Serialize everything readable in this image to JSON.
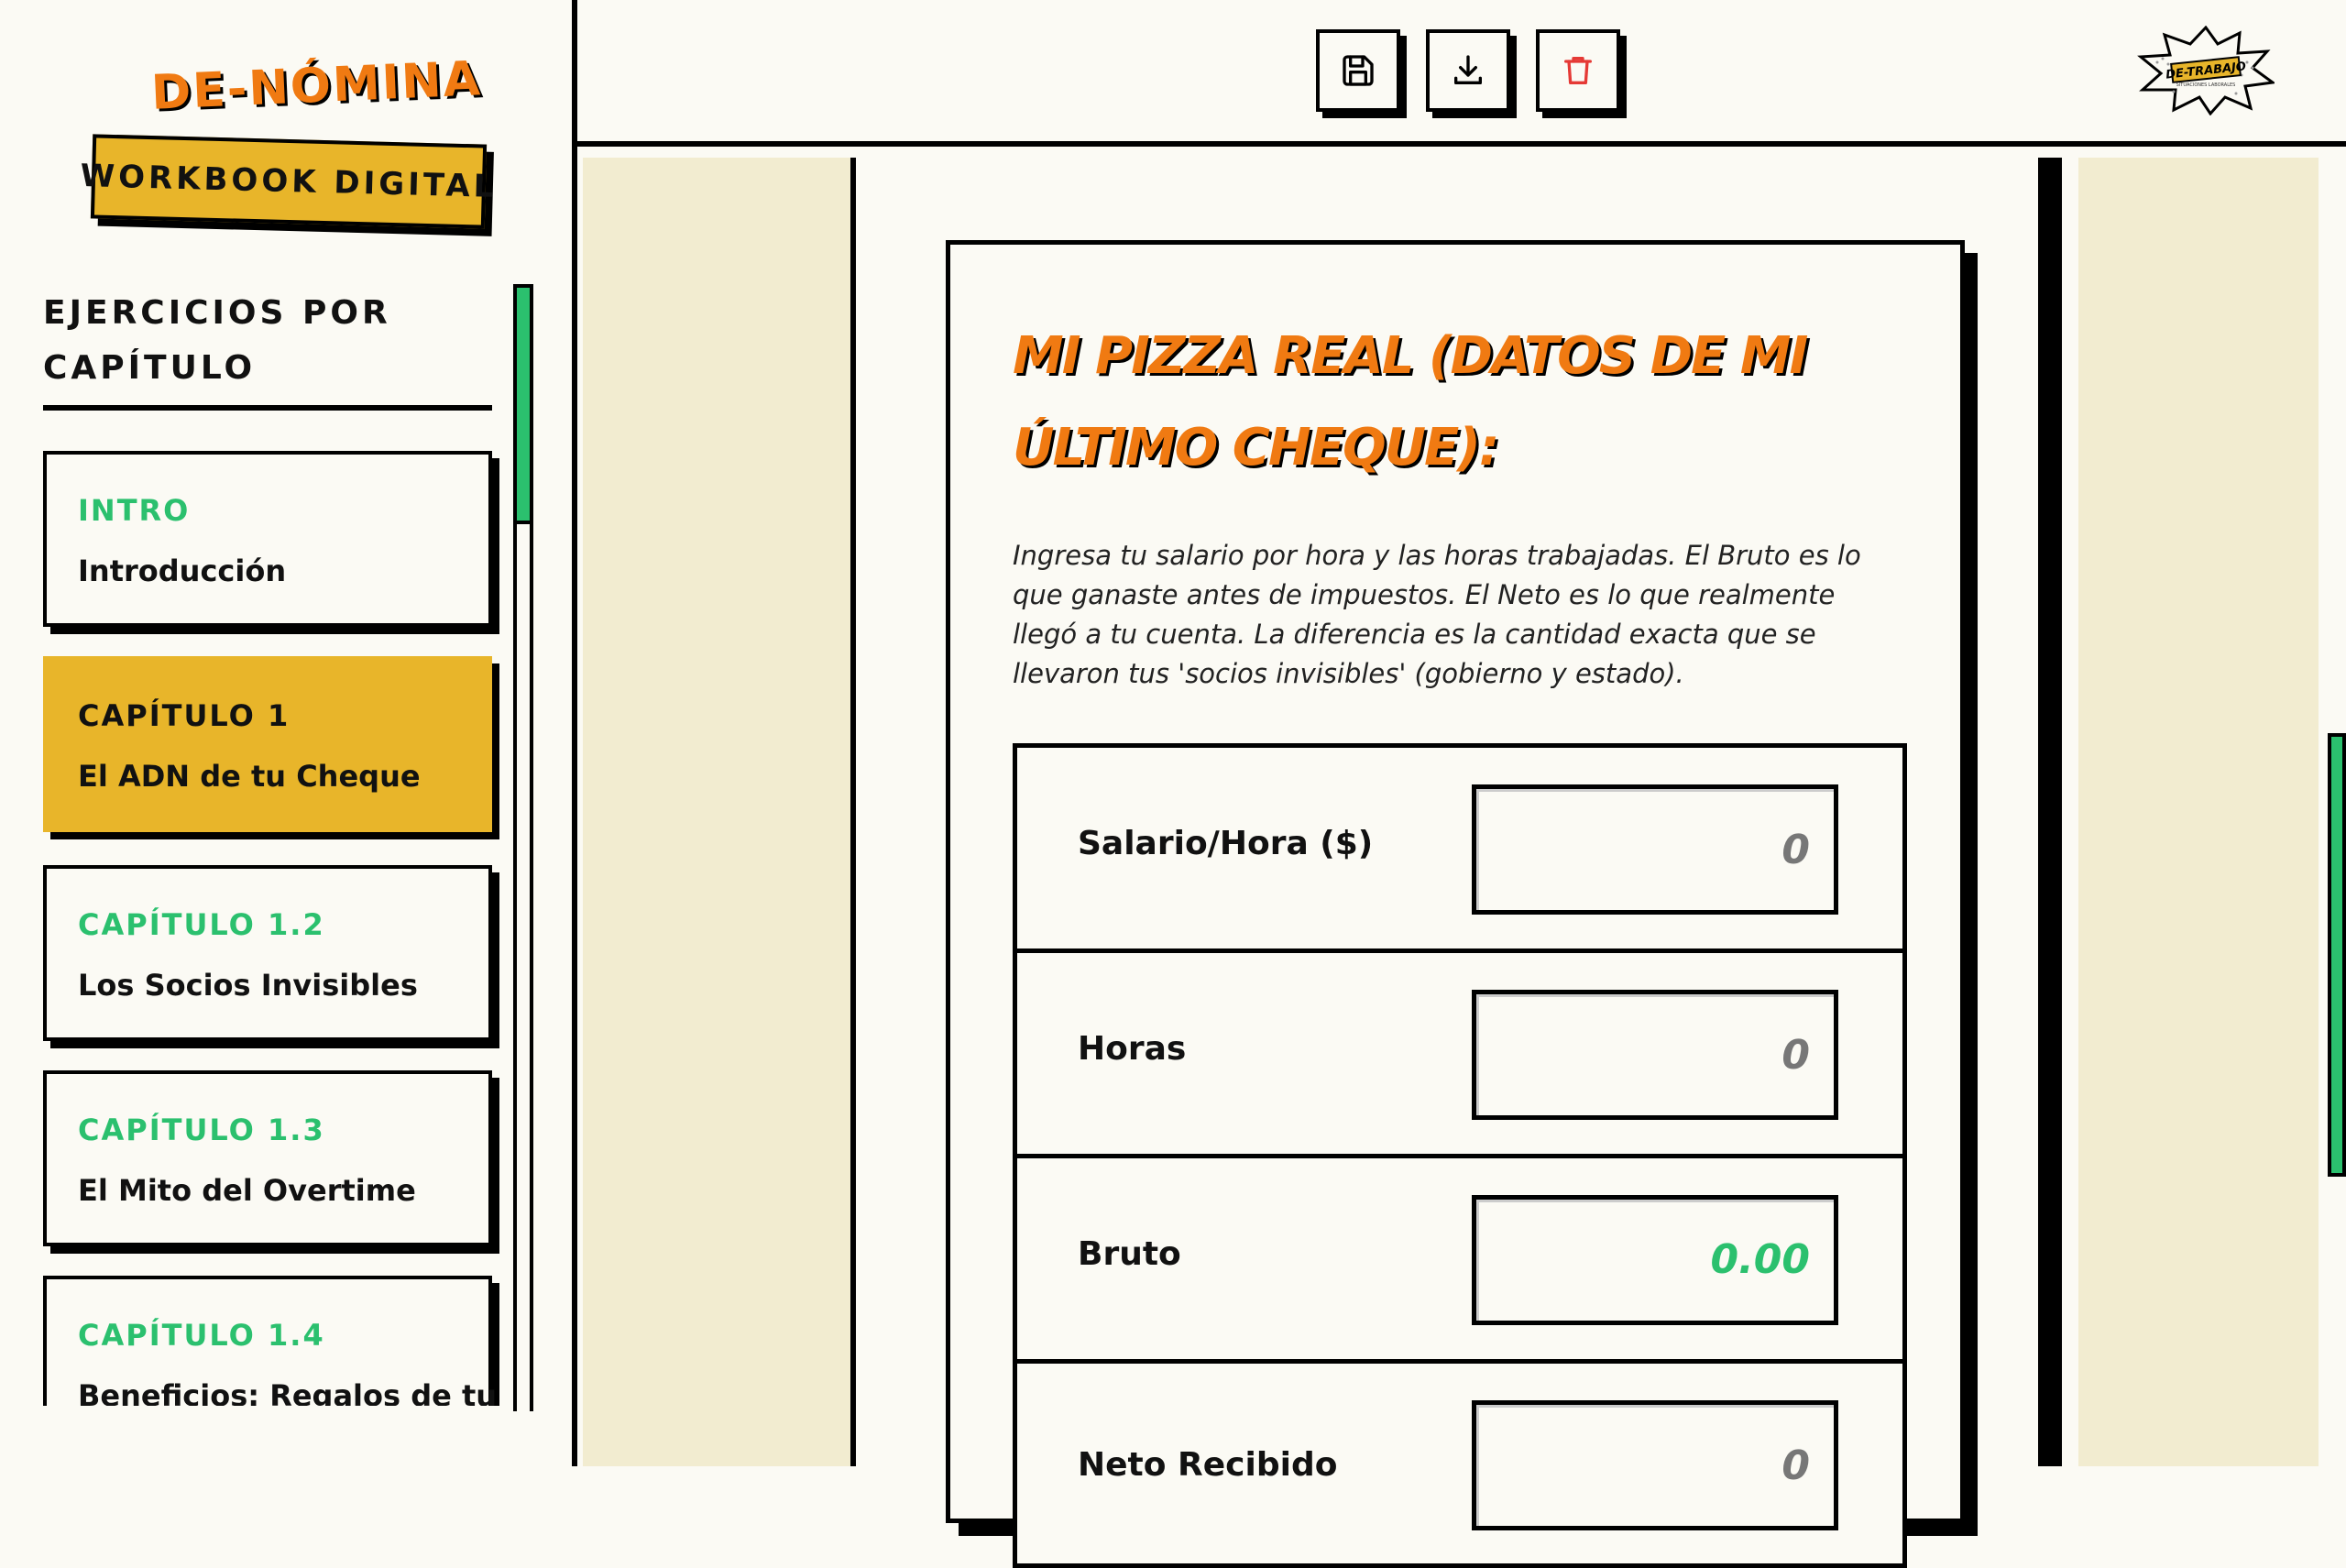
{
  "brand": {
    "title": "DE-NÓMINA",
    "subtitle": "WORKBOOK DIGITAL"
  },
  "sidebar": {
    "heading": "EJERCICIOS POR CAPÍTULO",
    "chapters": [
      {
        "tag": "INTRO",
        "name": "Introducción",
        "active": false
      },
      {
        "tag": "CAPÍTULO 1",
        "name": "El ADN de tu Cheque",
        "active": true
      },
      {
        "tag": "CAPÍTULO 1.2",
        "name": "Los Socios Invisibles",
        "active": false
      },
      {
        "tag": "CAPÍTULO 1.3",
        "name": "El Mito del Overtime",
        "active": false
      },
      {
        "tag": "CAPÍTULO 1.4",
        "name": "Beneficios: Regalos de tu",
        "active": false
      }
    ]
  },
  "toolbar": {
    "buttons": [
      {
        "icon": "save-icon",
        "color": "#000000"
      },
      {
        "icon": "download-icon",
        "color": "#000000"
      },
      {
        "icon": "trash-icon",
        "color": "#e53935"
      }
    ],
    "logo_text": "DE-TRABAJO",
    "logo_subtext": "SITUACIONES LABORALES"
  },
  "exercise": {
    "title": "Mi Pizza Real (Datos de mi último cheque):",
    "description": "Ingresa tu salario por hora y las horas trabajadas. El Bruto es lo que ganaste antes de impuestos. El Neto es lo que realmente llegó a tu cuenta. La diferencia es la cantidad exacta que se llevaron tus 'socios invisibles' (gobierno y estado).",
    "rows": [
      {
        "label": "Salario/Hora ($)",
        "placeholder": "0",
        "type": "input"
      },
      {
        "label": "Horas",
        "placeholder": "0",
        "type": "input"
      },
      {
        "label": "Bruto",
        "value": "0.00",
        "type": "output"
      },
      {
        "label": "Neto Recibido",
        "placeholder": "0",
        "type": "input"
      }
    ]
  },
  "colors": {
    "accent_orange": "#f07a12",
    "accent_green": "#2bc06e",
    "accent_yellow": "#e8b52a",
    "background": "#fbfaf4",
    "canvas": "#f2ecd0",
    "danger": "#e53935"
  }
}
